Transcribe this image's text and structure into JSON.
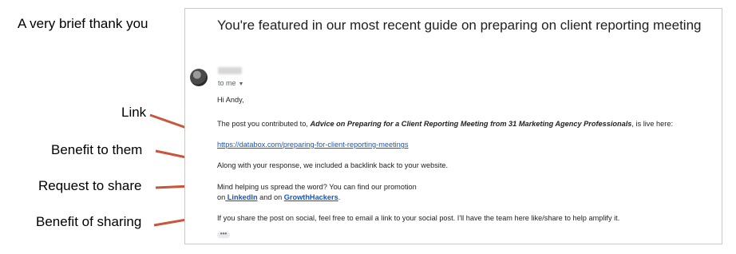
{
  "annotations": {
    "title": "A very brief thank you",
    "link": "Link",
    "benefit_to_them": "Benefit to them",
    "request_to_share": "Request to share",
    "benefit_of_sharing": "Benefit of sharing",
    "arrow_color": "#c7563c"
  },
  "email": {
    "subject": "You're featured in our most recent guide on preparing on client reporting meeting",
    "recipient": "to me",
    "greeting": "Hi Andy,",
    "intro_prefix": "The post you contributed to, ",
    "post_title": "Advice on Preparing for a Client Reporting Meeting from 31 Marketing Agency Professionals",
    "intro_suffix": ", is live here:",
    "url": "https://databox.com/preparing-for-client-reporting-meetings",
    "backlink_text": "Along with your response, we included a backlink back to your website.",
    "request_line1": "Mind helping us spread the word? You can find our promotion",
    "request_on": "on",
    "linkedin": " LinkedIn",
    "and_on": " and on ",
    "growthhackers": " GrowthHackers",
    "period": ".",
    "closing": "If you share the post on social, feel free to email a link to your social post. I'll have the team here like/share to help amplify it.",
    "more": "•••"
  }
}
